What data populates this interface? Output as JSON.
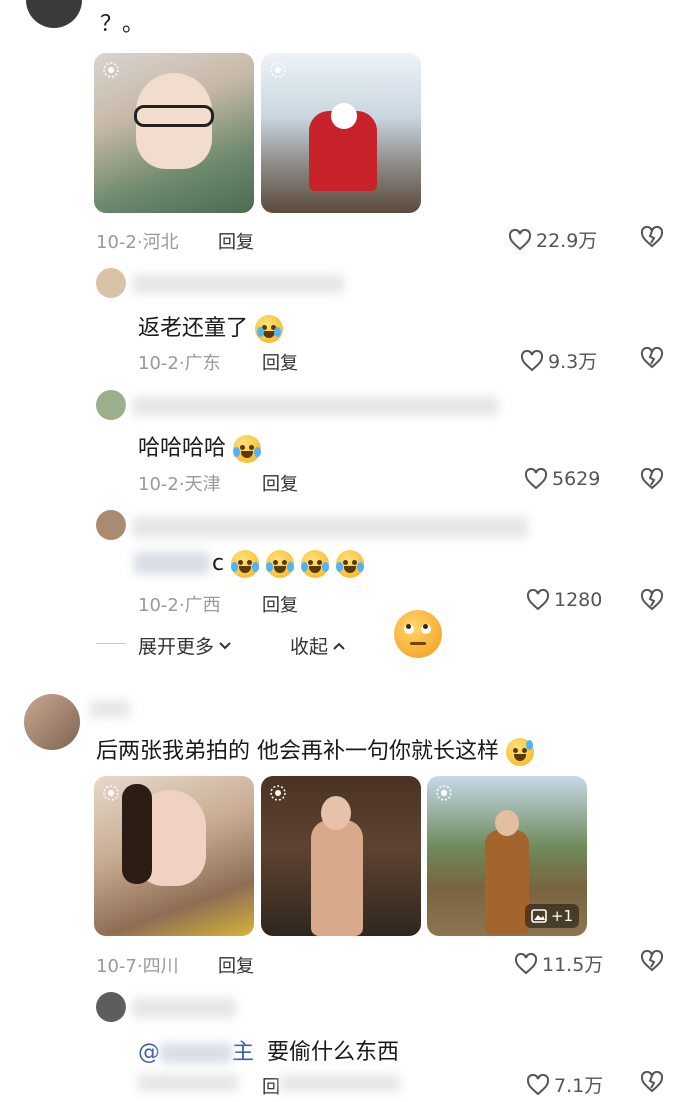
{
  "colors": {
    "meta_gray": "#9a9a9a",
    "like_gray": "#555555",
    "mention_blue": "#3b5fa6"
  },
  "comments": [
    {
      "text": "？。",
      "date": "10-2",
      "location": "河北",
      "reply": "回复",
      "likes": "22.9万"
    },
    {
      "text": "返老还童了",
      "date": "10-2",
      "location": "广东",
      "reply": "回复",
      "likes": "9.3万"
    },
    {
      "text": "哈哈哈哈",
      "date": "10-2",
      "location": "天津",
      "reply": "回复",
      "likes": "5629"
    },
    {
      "text": "c",
      "date": "10-2",
      "location": "广西",
      "reply": "回复",
      "likes": "1280"
    },
    {
      "text": "后两张我弟拍的 他会再补一句你就长这样",
      "date": "10-7",
      "location": "四川",
      "reply": "回复",
      "likes": "11.5万",
      "image_more": "+1"
    },
    {
      "mention": "@",
      "mention_tail": "主",
      "text": "要偷什么东西",
      "reply": "回",
      "likes": "7.1万"
    }
  ],
  "thread": {
    "expand_more": "展开更多",
    "collapse": "收起"
  },
  "icons": [
    "heart-icon",
    "broken-heart-icon",
    "live-photo-icon",
    "gallery-icon",
    "chevron-down-icon",
    "chevron-up-icon"
  ]
}
